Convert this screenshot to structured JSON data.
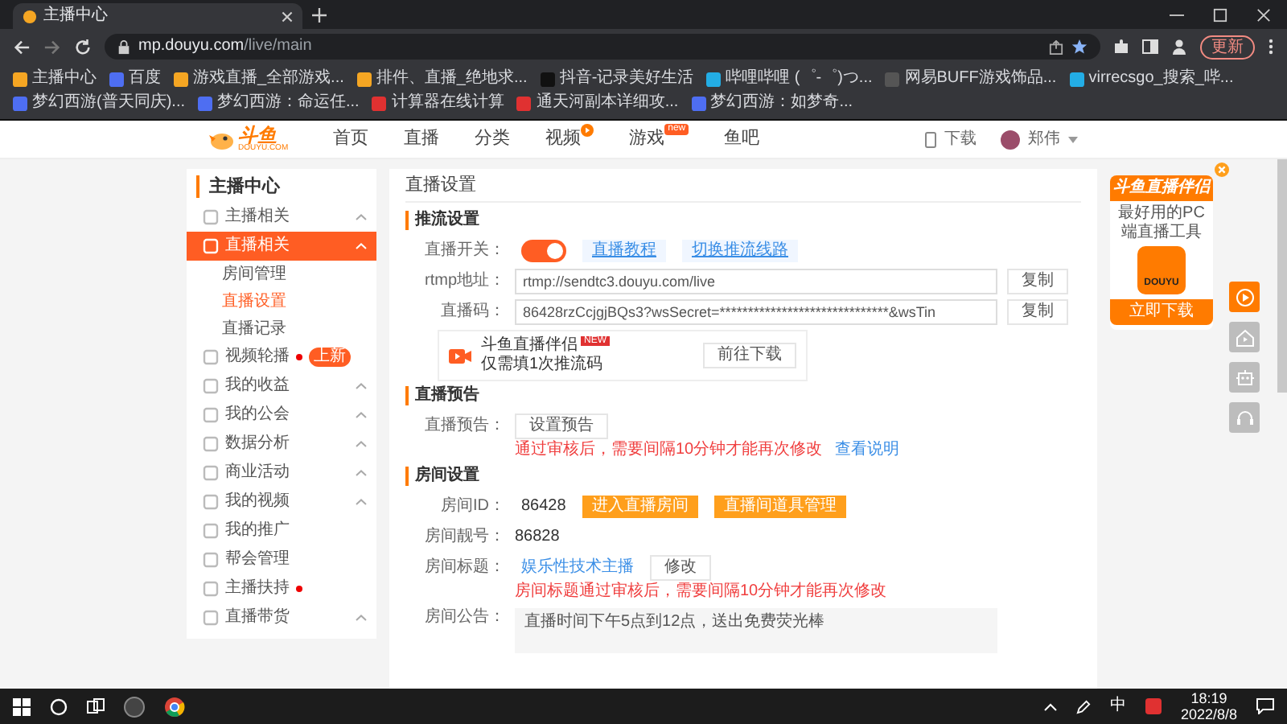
{
  "browser": {
    "tab_title": "主播中心",
    "url_host": "mp.douyu.com",
    "url_path": "/live/main",
    "update_button": "更新",
    "bookmarks": [
      {
        "label": "主播中心",
        "color": "#f5a623"
      },
      {
        "label": "百度",
        "color": "#4e6ef2"
      },
      {
        "label": "游戏直播_全部游戏...",
        "color": "#f5a623"
      },
      {
        "label": "排件、直播_绝地求...",
        "color": "#f5a623"
      },
      {
        "label": "抖音-记录美好生活",
        "color": "#111111"
      },
      {
        "label": "哔哩哔哩 (゜-゜)つ...",
        "color": "#23ade5"
      },
      {
        "label": "网易BUFF游戏饰品...",
        "color": "#555555"
      },
      {
        "label": "virrecsgo_搜索_哔...",
        "color": "#23ade5"
      },
      {
        "label": "梦幻西游(普天同庆)...",
        "color": "#4e6ef2"
      },
      {
        "label": "梦幻西游：命运任...",
        "color": "#4e6ef2"
      },
      {
        "label": "计算器在线计算",
        "color": "#e03131"
      },
      {
        "label": "通天河副本详细攻...",
        "color": "#e03131"
      },
      {
        "label": "梦幻西游：如梦奇...",
        "color": "#4e6ef2"
      }
    ]
  },
  "header": {
    "logo_text": "斗鱼",
    "logo_sub": "DOUYU.COM",
    "nav": [
      {
        "label": "首页"
      },
      {
        "label": "直播"
      },
      {
        "label": "分类"
      },
      {
        "label": "视频",
        "play_badge": true
      },
      {
        "label": "游戏",
        "badge": "new"
      },
      {
        "label": "鱼吧"
      }
    ],
    "download": "下载",
    "user": "郑伟"
  },
  "sidebar": {
    "title": "主播中心",
    "items": [
      {
        "label": "主播相关",
        "selected": false,
        "collapsible": true,
        "dot": false
      },
      {
        "label": "直播相关",
        "selected": true,
        "collapsible": true,
        "dot": false,
        "children": [
          {
            "label": "房间管理",
            "selected": false
          },
          {
            "label": "直播设置",
            "selected": true
          },
          {
            "label": "直播记录",
            "selected": false
          }
        ]
      },
      {
        "label": "视频轮播",
        "selected": false,
        "collapsible": false,
        "dot": true,
        "tag": "上新"
      },
      {
        "label": "我的收益",
        "selected": false,
        "collapsible": true,
        "dot": false
      },
      {
        "label": "我的公会",
        "selected": false,
        "collapsible": true,
        "dot": false
      },
      {
        "label": "数据分析",
        "selected": false,
        "collapsible": true,
        "dot": false
      },
      {
        "label": "商业活动",
        "selected": false,
        "collapsible": true,
        "dot": false
      },
      {
        "label": "我的视频",
        "selected": false,
        "collapsible": true,
        "dot": false
      },
      {
        "label": "我的推广",
        "selected": false,
        "collapsible": false,
        "dot": false
      },
      {
        "label": "帮会管理",
        "selected": false,
        "collapsible": false,
        "dot": false
      },
      {
        "label": "主播扶持",
        "selected": false,
        "collapsible": false,
        "dot": true
      },
      {
        "label": "直播带货",
        "selected": false,
        "collapsible": true,
        "dot": false
      }
    ]
  },
  "main": {
    "page_title": "直播设置",
    "stream": {
      "heading": "推流设置",
      "switch_label": "直播开关：",
      "switch_on": true,
      "links": [
        "直播教程",
        "切换推流线路"
      ],
      "rtmp_label": "rtmp地址：",
      "rtmp_value": "rtmp://sendtc3.douyu.com/live",
      "rtmp_copy": "复制",
      "code_label": "直播码：",
      "code_value": "86428rzCcjgjBQs3?wsSecret=******************************&wsTin",
      "code_copy": "复制",
      "promo": {
        "title": "斗鱼直播伴侣",
        "badge": "NEW",
        "subtitle": "仅需填1次推流码",
        "button": "前往下载"
      }
    },
    "preview": {
      "heading": "直播预告",
      "label": "直播预告：",
      "button": "设置预告",
      "warning": "通过审核后，需要间隔10分钟才能再次修改",
      "link": "查看说明"
    },
    "room": {
      "heading": "房间设置",
      "id_label": "房间ID：",
      "id_value": "86428",
      "buttons": [
        "进入直播房间",
        "直播间道具管理"
      ],
      "number_label": "房间靓号：",
      "number_value": "86828",
      "title_label": "房间标题：",
      "title_value": "娱乐性技术主播",
      "title_button": "修改",
      "title_warning": "房间标题通过审核后，需要间隔10分钟才能再次修改",
      "notice_label": "房间公告：",
      "notice_value": "直播时间下午5点到12点，送出免费荧光棒"
    }
  },
  "float_ad": {
    "title": "斗鱼直播伴侣",
    "subtitle": "最好用的PC端直播工具",
    "app_name": "DOUYU",
    "button": "立即下载"
  },
  "side_tools": [
    {
      "kind": "play",
      "selected": true
    },
    {
      "kind": "home",
      "selected": false
    },
    {
      "kind": "robot",
      "selected": false
    },
    {
      "kind": "headset",
      "selected": false
    }
  ],
  "taskbar": {
    "ime": "中",
    "time": "18:19",
    "date": "2022/8/8"
  }
}
